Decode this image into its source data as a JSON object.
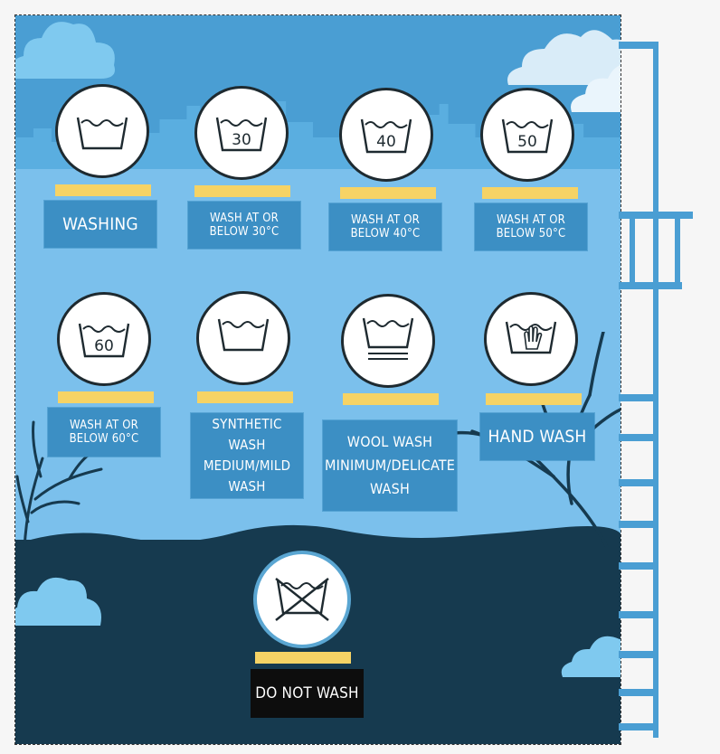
{
  "colors": {
    "sky_top": "#4a9ed3",
    "sky": "#7bc0ec",
    "ground": "#163a4f",
    "label_blue": "#3c8fc4",
    "bar_yellow": "#f6d365",
    "symbol_border": "#1e2a30"
  },
  "symbols": [
    {
      "id": "washing",
      "icon": "washtub-icon",
      "label": "WASHING"
    },
    {
      "id": "wash-30",
      "icon": "washtub-30-icon",
      "temp": "30",
      "label": "Wash at or below 30°C"
    },
    {
      "id": "wash-40",
      "icon": "washtub-40-icon",
      "temp": "40",
      "label": "Wash at or below 40°C"
    },
    {
      "id": "wash-50",
      "icon": "washtub-50-icon",
      "temp": "50",
      "label": "Wash at or below 50°C"
    },
    {
      "id": "wash-60",
      "icon": "washtub-60-icon",
      "temp": "60",
      "label": "Wash at or below 60°C"
    },
    {
      "id": "synthetic",
      "icon": "washtub-one-bar-icon",
      "label": "Synthetic Wash Medium/Mild Wash"
    },
    {
      "id": "wool",
      "icon": "washtub-two-bars-icon",
      "label": "Wool Wash Minimum/Delicate Wash"
    },
    {
      "id": "hand",
      "icon": "hand-wash-icon",
      "label": "Hand Wash"
    },
    {
      "id": "do-not-wash",
      "icon": "crossed-washtub-icon",
      "label": "Do not Wash"
    }
  ]
}
